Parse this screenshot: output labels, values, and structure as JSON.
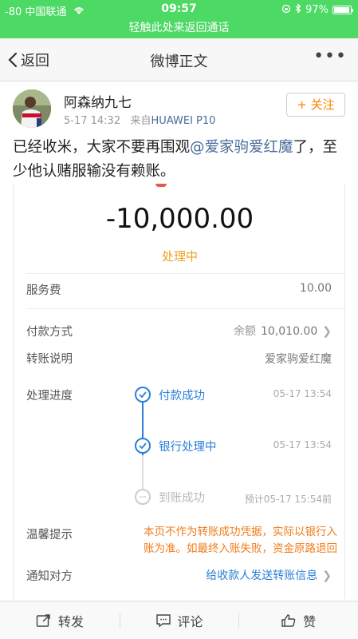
{
  "status_bar": {
    "carrier": "-80 中国联通",
    "time": "09:57",
    "battery": "97%",
    "battery_level": 0.97
  },
  "call_bar": {
    "text": "轻触此处来返回通话"
  },
  "nav": {
    "back_label": "返回",
    "title": "微博正文"
  },
  "post": {
    "username": "阿森纳九七",
    "time": "5-17 14:32",
    "source_prefix": "来自",
    "source": "HUAWEI P10",
    "follow_label": "+ 关注",
    "text_before": "已经收米，大家不要再围观",
    "mention": "@爱家驹爱红魔",
    "text_after": "了，至少他认赌服输没有赖账。"
  },
  "transfer": {
    "amount": "-10,000.00",
    "status": "处理中",
    "service_fee_label": "服务费",
    "service_fee": "10.00",
    "payment_method_label": "付款方式",
    "payment_method_key": "余额",
    "payment_method_value": "10,010.00",
    "note_label": "转账说明",
    "note_value": "爱家驹爱红魔",
    "progress_label": "处理进度",
    "steps": [
      {
        "label": "付款成功",
        "time": "05-17 13:54"
      },
      {
        "label": "银行处理中",
        "time": "05-17 13:54"
      },
      {
        "label": "到账成功",
        "time": "预计05-17 15:54前"
      }
    ],
    "tip_label": "温馨提示",
    "tip_line1": "本页不作为转账成功凭据，实际以银行入",
    "tip_line2": "账为准。如最终入账失败，资金原路退回",
    "notify_label": "通知对方",
    "notify_value": "给收款人发送转账信息"
  },
  "toolbar": {
    "repost": "转发",
    "comment": "评论",
    "like": "赞"
  }
}
